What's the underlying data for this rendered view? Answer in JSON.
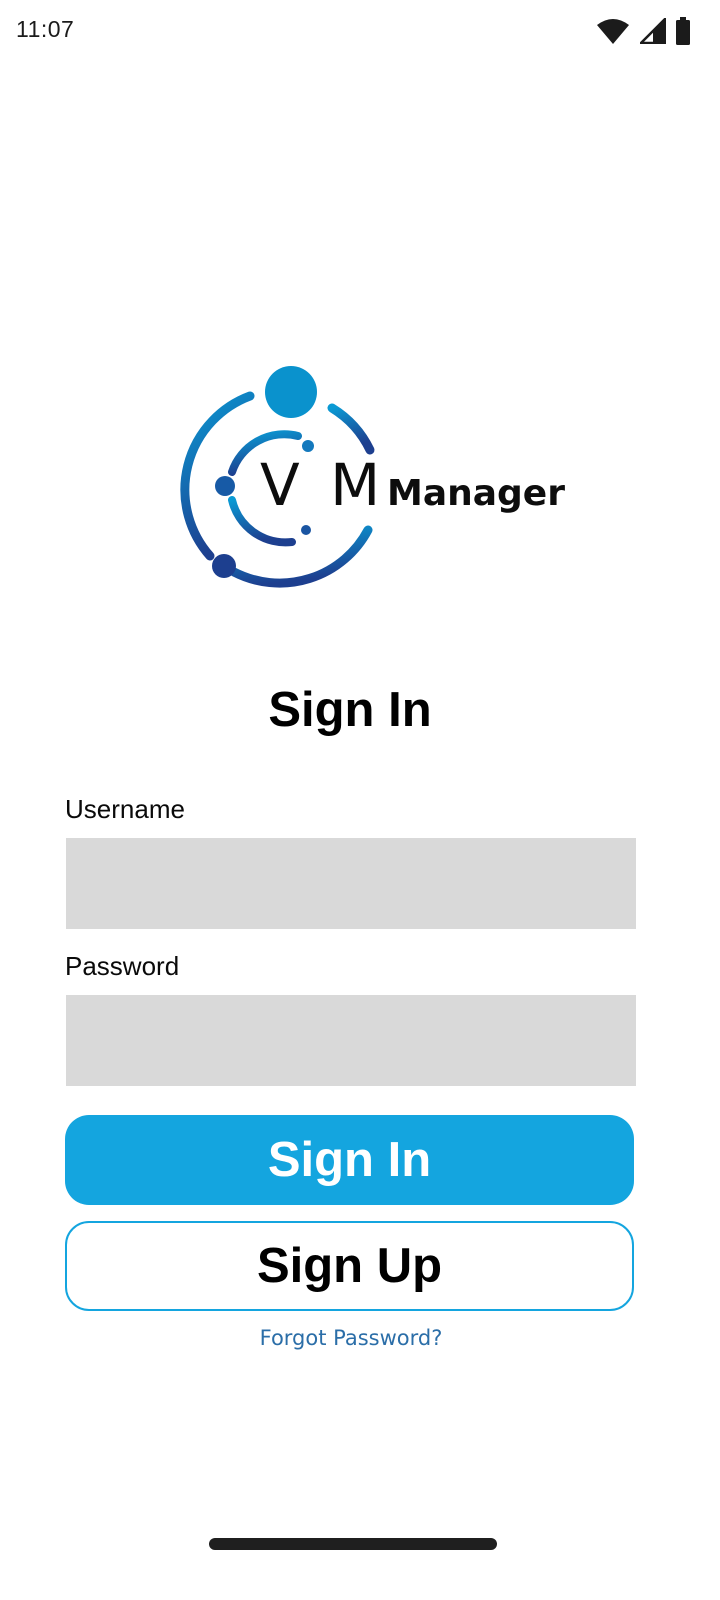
{
  "status_bar": {
    "time": "11:07",
    "icons": [
      "wifi-icon",
      "cell-signal-icon",
      "battery-icon"
    ]
  },
  "logo": {
    "text_vm": "V M",
    "text_manager": "Manager",
    "colors": {
      "gradient_start": "#0a9ad4",
      "gradient_end": "#1d3f8f"
    }
  },
  "sign_in_form": {
    "title": "Sign In",
    "username_label": "Username",
    "username_value": "",
    "password_label": "Password",
    "password_value": "",
    "sign_in_button": "Sign In",
    "sign_up_button": "Sign Up",
    "forgot_password_link": "Forgot Password?"
  },
  "colors": {
    "accent": "#14a5df",
    "input_background": "#d9d9d9",
    "link": "#2b6ea8"
  }
}
